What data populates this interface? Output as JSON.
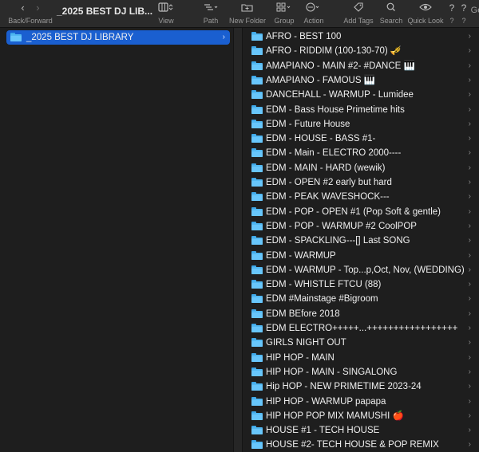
{
  "toolbar": {
    "back_forward_label": "Back/Forward",
    "back_icon": "chevron-left-icon",
    "forward_icon": "chevron-right-icon",
    "title": "_2025 BEST DJ LIB...",
    "view_label": "View",
    "path_label": "Path",
    "new_folder_label": "New Folder",
    "group_label": "Group",
    "action_label": "Action",
    "add_tags_label": "Add Tags",
    "search_label": "Search",
    "quick_look_label": "Quick Look",
    "help_label_1": "?",
    "help_label_2": "Ge"
  },
  "sidebar": {
    "selected_label": "_2025 BEST DJ LIBRARY"
  },
  "items": [
    "AFRO - BEST 100",
    "AFRO - RIDDIM (100-130-70)  🎺",
    "AMAPIANO -  MAIN #2- #DANCE 🎹",
    "AMAPIANO - FAMOUS 🎹",
    "DANCEHALL - WARMUP - Lumidee",
    "EDM - Bass House Primetime hits",
    "EDM - Future House",
    "EDM - HOUSE - BASS #1-",
    "EDM - Main - ELECTRO 2000----",
    "EDM - MAIN - HARD (wewik)",
    "EDM - OPEN #2 early but hard",
    "EDM - PEAK WAVESHOCK---",
    "EDM - POP - OPEN #1 (Pop Soft & gentle)",
    "EDM - POP - WARMUP #2 CoolPOP",
    "EDM - SPACKLING---[] Last SONG",
    "EDM - WARMUP",
    "EDM - WARMUP - Top...p,Oct, Nov, (WEDDING)",
    "EDM - WHISTLE FTCU (88)",
    "EDM #Mainstage  #Bigroom",
    "EDM BEfore 2018",
    "EDM ELECTRO+++++...+++++++++++++++++",
    "GIRLS NIGHT OUT",
    "HIP HOP - MAIN",
    "HIP HOP - MAIN - SINGALONG",
    "Hip HOP - NEW PRIMETIME 2023-24",
    "HIP HOP - WARMUP papapa",
    "HIP HOP POP MIX MAMUSHI 🍎",
    "HOUSE #1  - TECH HOUSE",
    "HOUSE #2- TECH HOUSE & POP REMIX"
  ],
  "colors": {
    "selection": "#1a5fd0",
    "folder": "#52b8f2"
  }
}
